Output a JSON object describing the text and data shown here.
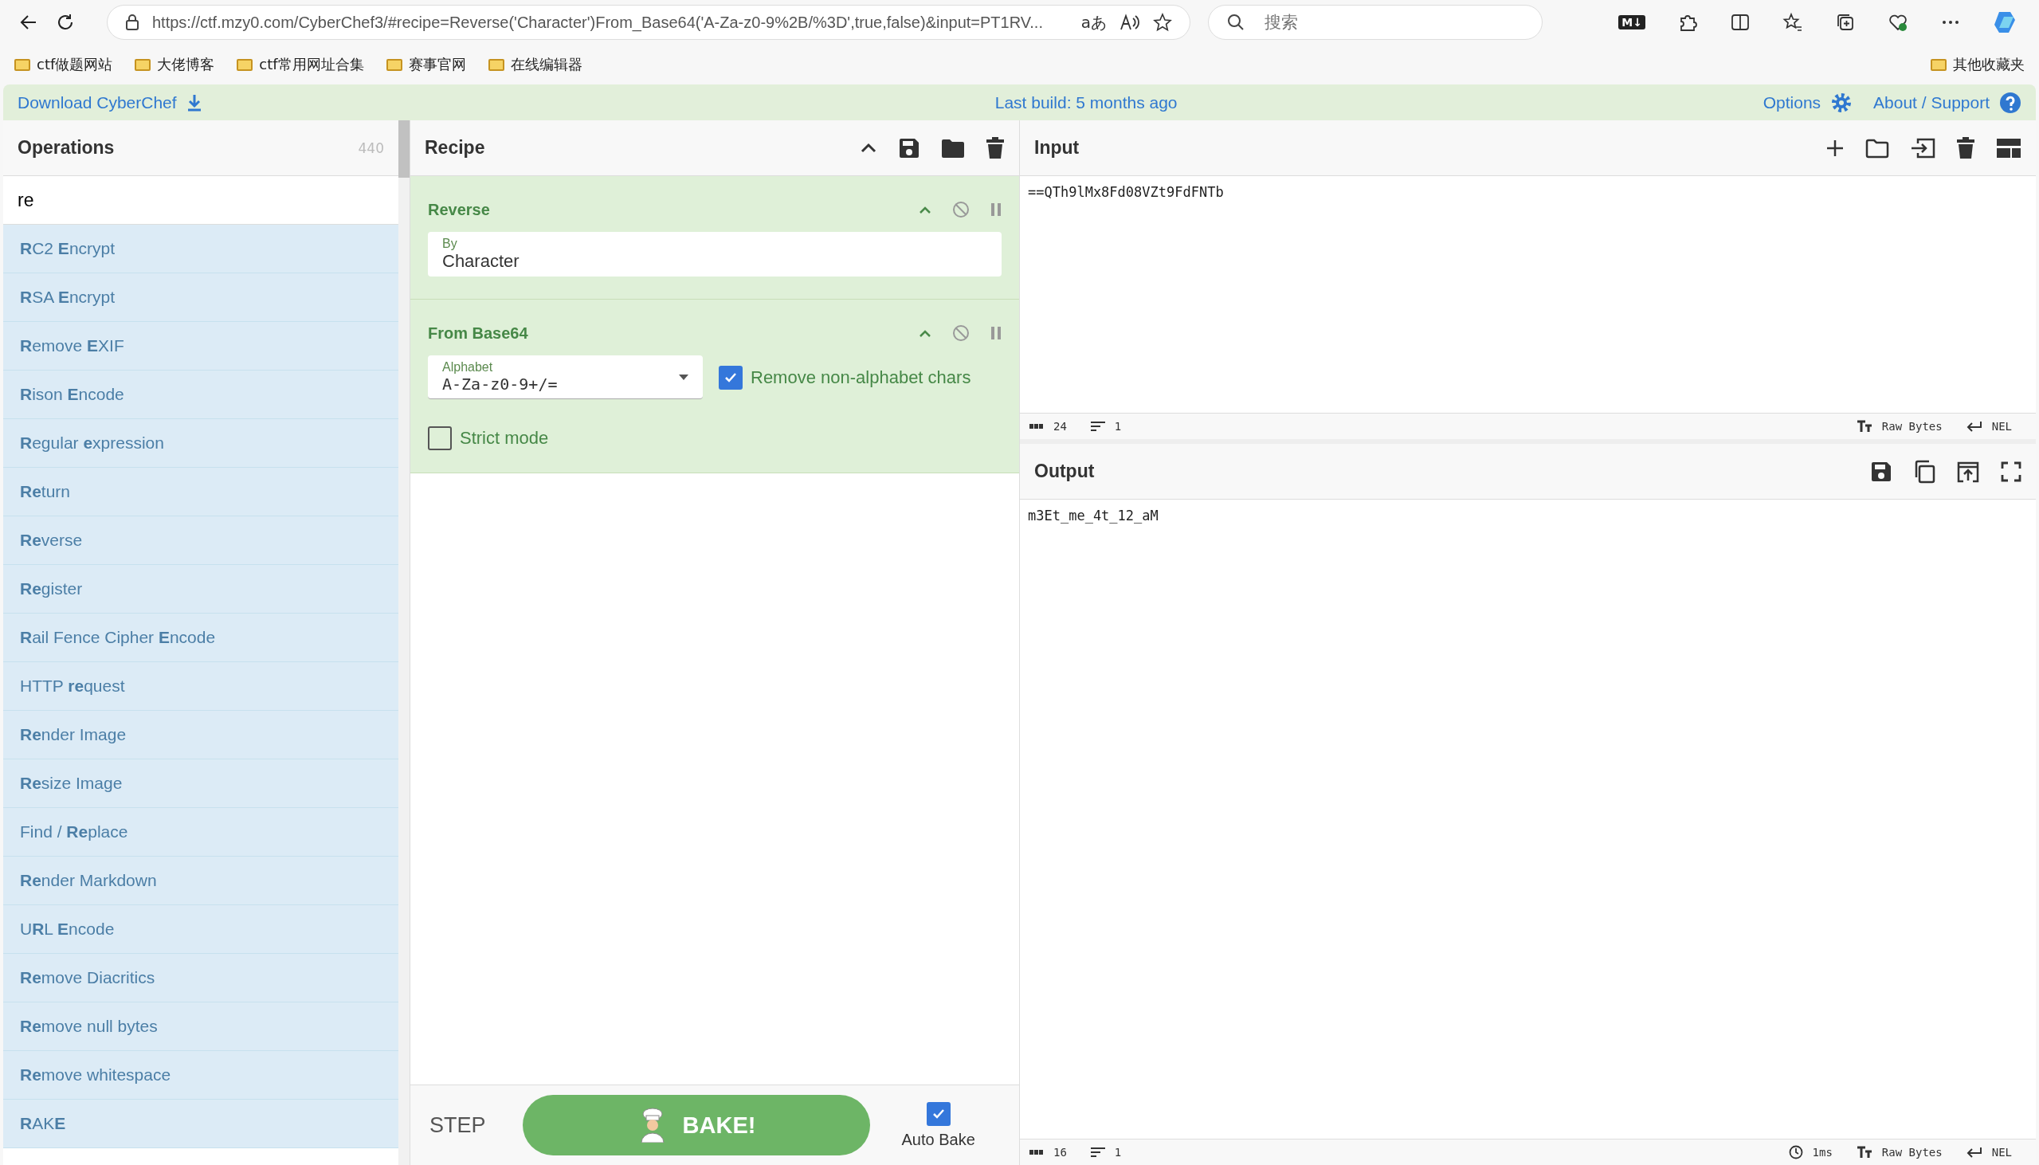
{
  "browser": {
    "url": "https://ctf.mzy0.com/CyberChef3/#recipe=Reverse('Character')From_Base64('A-Za-z0-9%2B/%3D',true,false)&input=PT1RV...",
    "translate_glyph": "aあ",
    "search_placeholder": "搜索",
    "extension_badge": "M↓",
    "bookmarks": [
      "ctf做题网站",
      "大佬博客",
      "ctf常用网址合集",
      "赛事官网",
      "在线编辑器"
    ],
    "other_bookmarks": "其他收藏夹"
  },
  "banner": {
    "download": "Download CyberChef",
    "build": "Last build: 5 months ago",
    "options": "Options",
    "about": "About / Support"
  },
  "operations": {
    "title": "Operations",
    "count": "440",
    "search_value": "re",
    "items": [
      "**R**C2 **E**ncrypt",
      "**R**SA **E**ncrypt",
      "**R**emove **E**XIF",
      "**R**ison **E**ncode",
      "**R**egular **e**xpression",
      "**Re**turn",
      "**Re**verse",
      "**Re**gister",
      "**R**ail Fence Cipher **E**ncode",
      "HTTP **re**quest",
      "**Re**nder Image",
      "**Re**size Image",
      "Find / **Re**place",
      "**Re**nder Markdown",
      "U**R**L **E**ncode",
      "**Re**move Diacritics",
      "**Re**move null bytes",
      "**Re**move whitespace",
      "**R**AK**E**"
    ]
  },
  "recipe": {
    "title": "Recipe",
    "ops": [
      {
        "name": "Reverse",
        "fields": [
          {
            "kind": "text",
            "label": "By",
            "value": "Character"
          }
        ]
      },
      {
        "name": "From Base64",
        "fields": [
          {
            "kind": "dropdown",
            "label": "Alphabet",
            "value": "A-Za-z0-9+/="
          },
          {
            "kind": "checkbox",
            "label": "Remove non-alphabet chars",
            "checked": true
          },
          {
            "kind": "checkbox",
            "label": "Strict mode",
            "checked": false
          }
        ]
      }
    ],
    "step": "STEP",
    "bake": "BAKE!",
    "auto_bake": {
      "label": "Auto Bake",
      "checked": true
    }
  },
  "input": {
    "title": "Input",
    "value": "==QTh9lMx8Fd08VZt9FdFNTb",
    "chars": "24",
    "lines": "1",
    "encoding": "Raw Bytes",
    "eol": "NEL"
  },
  "output": {
    "title": "Output",
    "value": "m3Et_me_4t_12_aM",
    "chars": "16",
    "lines": "1",
    "time": "1ms",
    "encoding": "Raw Bytes",
    "eol": "NEL"
  }
}
